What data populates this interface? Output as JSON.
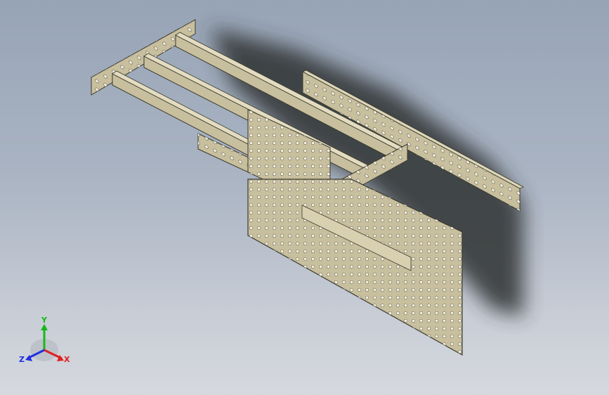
{
  "viewport": {
    "background_top": "#97a4b6",
    "background_bottom": "#d6d9de"
  },
  "model": {
    "part_color": "#c8bf9e",
    "part_edge_color": "#3a3a2e",
    "hole_color": "#f3f0e4",
    "shadow_color": "#2e3033"
  },
  "triad": {
    "x_label": "X",
    "y_label": "Y",
    "z_label": "Z",
    "x_color": "#e02020",
    "y_color": "#18b818",
    "z_color": "#2030e0"
  }
}
